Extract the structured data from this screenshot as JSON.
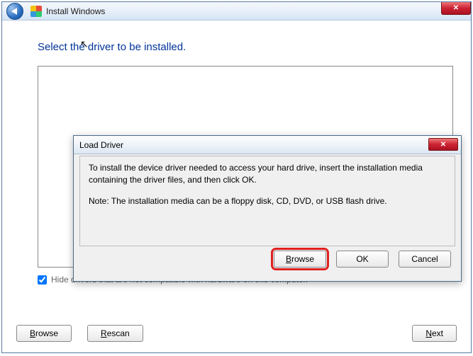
{
  "titlebar": {
    "text": "Install Windows"
  },
  "heading": "Select the driver to be installed.",
  "hide_checkbox": {
    "label": "Hide drivers that are not compatible with hardware on this computer.",
    "checked": true
  },
  "buttons": {
    "browse": "Browse",
    "rescan": "Rescan",
    "next": "Next"
  },
  "modal": {
    "title": "Load Driver",
    "body_line1": "To install the device driver needed to access your hard drive, insert the installation media containing the driver files, and then click OK.",
    "body_line2": "Note: The installation media can be a floppy disk, CD, DVD, or USB flash drive.",
    "buttons": {
      "browse": "Browse",
      "ok": "OK",
      "cancel": "Cancel"
    }
  }
}
